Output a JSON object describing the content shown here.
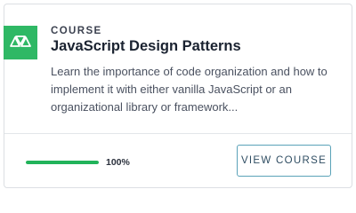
{
  "course": {
    "kicker": "COURSE",
    "title": "JavaScript Design Patterns",
    "description": "Learn the importance of code organization and how to implement it with either vanilla JavaScript or an organizational library or framework...",
    "logo_icon": "brand-triangles-icon"
  },
  "progress": {
    "value": 1.0,
    "label": "100%"
  },
  "actions": {
    "view_course_label": "VIEW COURSE"
  },
  "colors": {
    "brand_green": "#2fb865",
    "progress_green": "#21b35a",
    "button_border": "#5aa2b8"
  }
}
